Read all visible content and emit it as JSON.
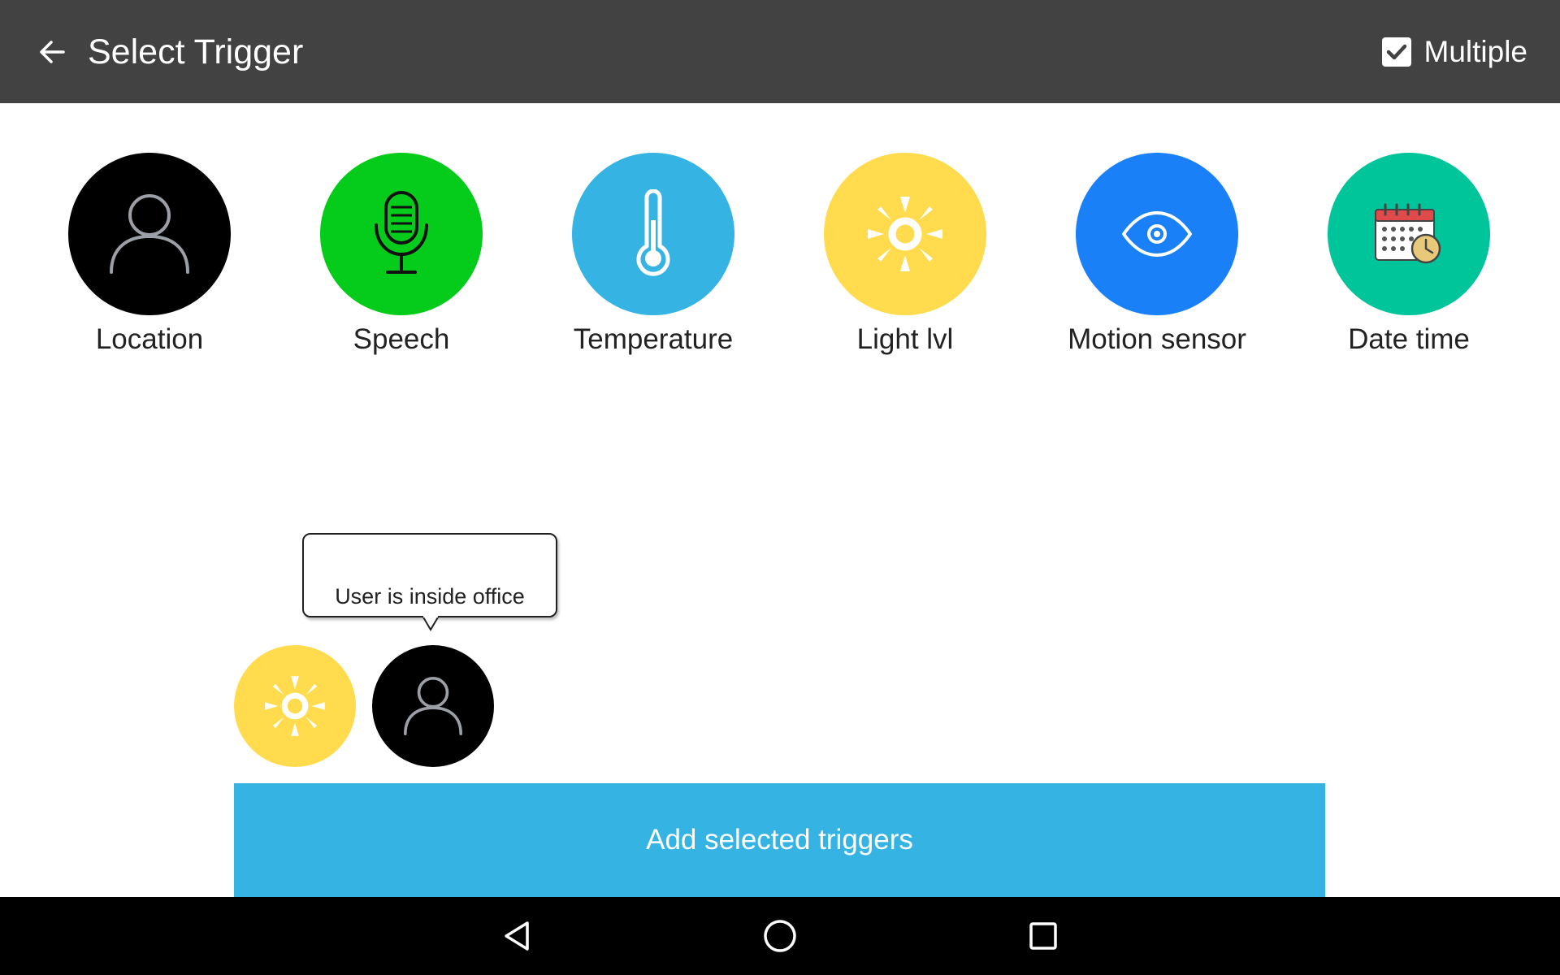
{
  "app_bar": {
    "title": "Select Trigger",
    "back_icon": "arrow-left-icon",
    "multiple": {
      "label": "Multiple",
      "checked": true
    }
  },
  "triggers": [
    {
      "label": "Location",
      "icon": "person-icon",
      "color": "#000000"
    },
    {
      "label": "Speech",
      "icon": "microphone-icon",
      "color": "#05cc1b"
    },
    {
      "label": "Temperature",
      "icon": "thermometer-icon",
      "color": "#35b4e4"
    },
    {
      "label": "Light lvl",
      "icon": "sun-icon",
      "color": "#ffdb4d"
    },
    {
      "label": "Motion sensor",
      "icon": "eye-icon",
      "color": "#1a80f8"
    },
    {
      "label": "Date time",
      "icon": "calendar-clock-icon",
      "color": "#00c49a"
    }
  ],
  "selected_triggers": [
    {
      "icon": "sun-icon",
      "color": "#ffdb4d"
    },
    {
      "icon": "person-icon",
      "color": "#000000"
    }
  ],
  "tooltip": {
    "text": "User is inside office"
  },
  "add_button": {
    "label": "Add selected triggers",
    "color": "#35b4e4"
  },
  "nav_bar": {
    "icons": [
      "back-triangle-icon",
      "home-circle-icon",
      "recents-square-icon"
    ]
  }
}
